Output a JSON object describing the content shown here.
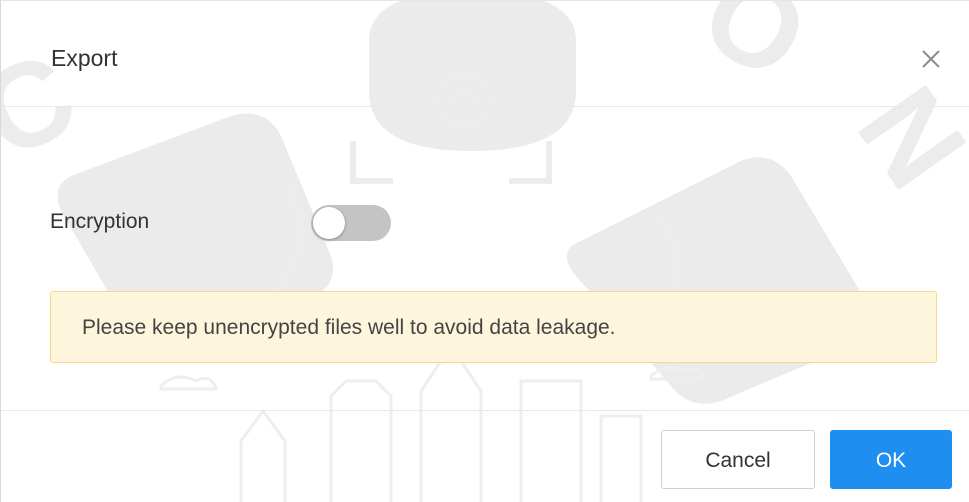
{
  "dialog": {
    "title": "Export",
    "close_icon": "close-icon"
  },
  "encryption": {
    "label": "Encryption",
    "enabled": false
  },
  "notice": {
    "text": "Please keep unencrypted files well to avoid data leakage."
  },
  "footer": {
    "cancel_label": "Cancel",
    "ok_label": "OK"
  },
  "colors": {
    "primary": "#1e8ff0",
    "notice_bg": "#fdf6dd",
    "notice_border": "#f4d98a",
    "toggle_off": "#c4c4c4"
  }
}
